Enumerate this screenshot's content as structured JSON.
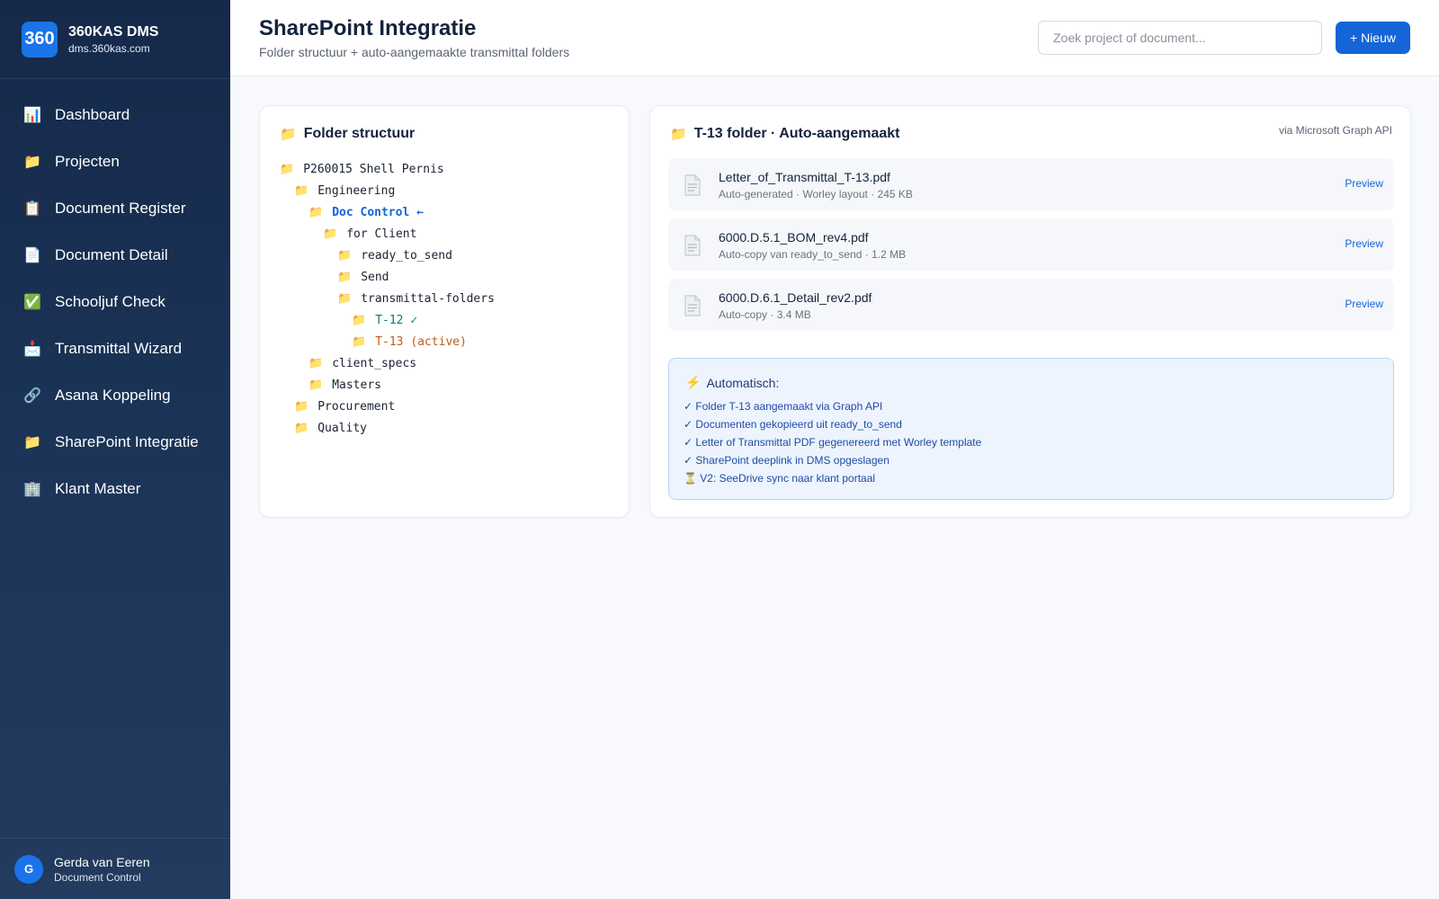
{
  "brand": {
    "logo": "360",
    "name": "360KAS DMS",
    "domain": "dms.360kas.com"
  },
  "sidebar": {
    "items": [
      {
        "label": "Dashboard",
        "icon": "bar-chart-icon",
        "glyph": "📊"
      },
      {
        "label": "Projecten",
        "icon": "folder-icon",
        "glyph": "📁"
      },
      {
        "label": "Document Register",
        "icon": "clipboard-icon",
        "glyph": "📋"
      },
      {
        "label": "Document Detail",
        "icon": "page-icon",
        "glyph": "📄"
      },
      {
        "label": "Schooljuf Check",
        "icon": "check-box-icon",
        "glyph": "✅"
      },
      {
        "label": "Transmittal Wizard",
        "icon": "mailbox-icon",
        "glyph": "📩"
      },
      {
        "label": "Asana Koppeling",
        "icon": "link-icon",
        "glyph": "🔗"
      },
      {
        "label": "SharePoint Integratie",
        "icon": "folder-icon",
        "glyph": "📁"
      },
      {
        "label": "Klant Master",
        "icon": "building-icon",
        "glyph": "🏢"
      }
    ]
  },
  "user": {
    "initial": "G",
    "name": "Gerda van Eeren",
    "role": "Document Control"
  },
  "header": {
    "title": "SharePoint Integratie",
    "subtitle": "Folder structuur + auto-aangemaakte transmittal folders",
    "search_placeholder": "Zoek project of document...",
    "new_button": "+ Nieuw"
  },
  "folder_tree": {
    "title": "Folder structuur",
    "rows": [
      {
        "label": "P260015 Shell Pernis",
        "depth": 0,
        "style": ""
      },
      {
        "label": "Engineering",
        "depth": 1,
        "style": ""
      },
      {
        "label": "Doc Control ←",
        "depth": 2,
        "style": "blue"
      },
      {
        "label": "for Client",
        "depth": 3,
        "style": ""
      },
      {
        "label": "ready_to_send",
        "depth": 4,
        "style": ""
      },
      {
        "label": "Send",
        "depth": 4,
        "style": ""
      },
      {
        "label": "transmittal-folders",
        "depth": 4,
        "style": ""
      },
      {
        "label": "T-12 ✓",
        "depth": 5,
        "style": "teal"
      },
      {
        "label": "T-13 (active)",
        "depth": 5,
        "style": "orange"
      },
      {
        "label": "client_specs",
        "depth": 2,
        "style": ""
      },
      {
        "label": "Masters",
        "depth": 2,
        "style": ""
      },
      {
        "label": "Procurement",
        "depth": 1,
        "style": ""
      },
      {
        "label": "Quality",
        "depth": 1,
        "style": ""
      }
    ]
  },
  "t13_panel": {
    "title": "T-13 folder · Auto-aangemaakt",
    "via": "via Microsoft Graph API",
    "documents": [
      {
        "name": "Letter_of_Transmittal_T-13.pdf",
        "meta": "Auto-generated · Worley layout · 245 KB",
        "action": "Preview"
      },
      {
        "name": "6000.D.5.1_BOM_rev4.pdf",
        "meta": "Auto-copy van ready_to_send · 1.2 MB",
        "action": "Preview"
      },
      {
        "name": "6000.D.6.1_Detail_rev2.pdf",
        "meta": "Auto-copy · 3.4 MB",
        "action": "Preview"
      }
    ],
    "automatic": {
      "title": "Automatisch:",
      "items": [
        "✓ Folder T-13 aangemaakt via Graph API",
        "✓ Documenten gekopieerd uit ready_to_send",
        "✓ Letter of Transmittal PDF gegenereerd met Worley template",
        "✓ SharePoint deeplink in DMS opgeslagen",
        "⏳ V2: SeeDrive sync naar klant portaal"
      ]
    }
  },
  "colors": {
    "accent": "#1565d8",
    "sidebar_bg": "#1c3558",
    "active_folder": "#c25a16",
    "done_folder": "#0f7a73",
    "folder": "#f5b82e"
  }
}
